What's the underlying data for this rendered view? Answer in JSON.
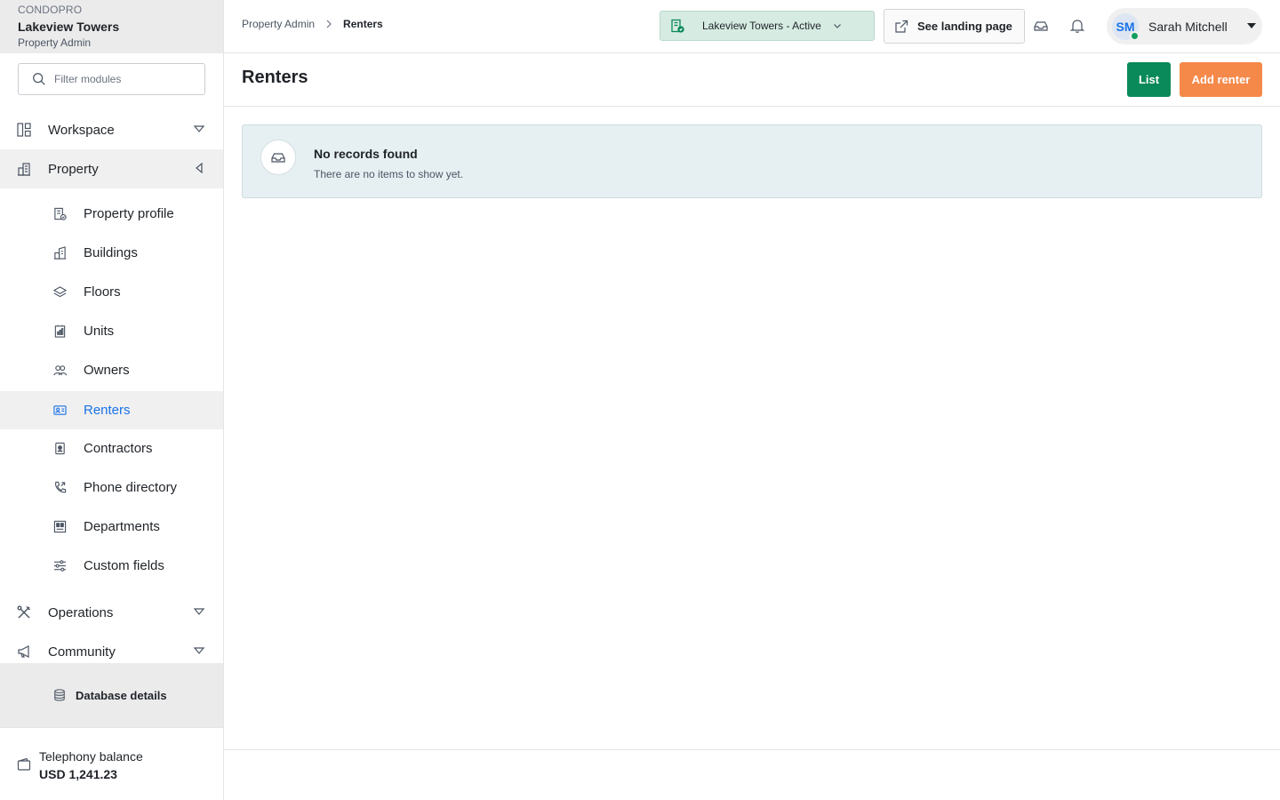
{
  "sidebar": {
    "brand": "CONDOPRO",
    "property_name": "Lakeview Towers",
    "role": "Property Admin",
    "filter_placeholder": "Filter modules",
    "groups": {
      "workspace": "Workspace",
      "property": "Property",
      "operations": "Operations",
      "community": "Community"
    },
    "items": [
      {
        "label": "Property profile",
        "icon": "building-profile-icon"
      },
      {
        "label": "Buildings",
        "icon": "buildings-icon"
      },
      {
        "label": "Floors",
        "icon": "layers-icon"
      },
      {
        "label": "Units",
        "icon": "units-icon"
      },
      {
        "label": "Owners",
        "icon": "users-icon"
      },
      {
        "label": "Renters",
        "icon": "id-card-icon"
      },
      {
        "label": "Contractors",
        "icon": "badge-icon"
      },
      {
        "label": "Phone directory",
        "icon": "phone-icon"
      },
      {
        "label": "Departments",
        "icon": "departments-icon"
      },
      {
        "label": "Custom fields",
        "icon": "sliders-icon"
      }
    ],
    "selected_item": "Renters",
    "database_label": "Database details",
    "balance_label": "Telephony balance",
    "balance_value": "USD 1,241.23"
  },
  "topbar": {
    "breadcrumb_root": "Property Admin",
    "breadcrumb_current": "Renters",
    "property_select": "Lakeview Towers - Active",
    "landing_button": "See landing page",
    "user_initials": "SM",
    "user_name": "Sarah Mitchell"
  },
  "page": {
    "title": "Renters",
    "list_button": "List",
    "add_button": "Add renter"
  },
  "empty_state": {
    "title": "No records found",
    "subtitle": "There are no items to show yet."
  },
  "colors": {
    "accent_blue": "#1a73e8",
    "primary_green": "#0a8a5a",
    "add_orange": "#f5894a",
    "status_green_bg": "#d6ebe2",
    "empty_bg": "#e6eff2"
  }
}
